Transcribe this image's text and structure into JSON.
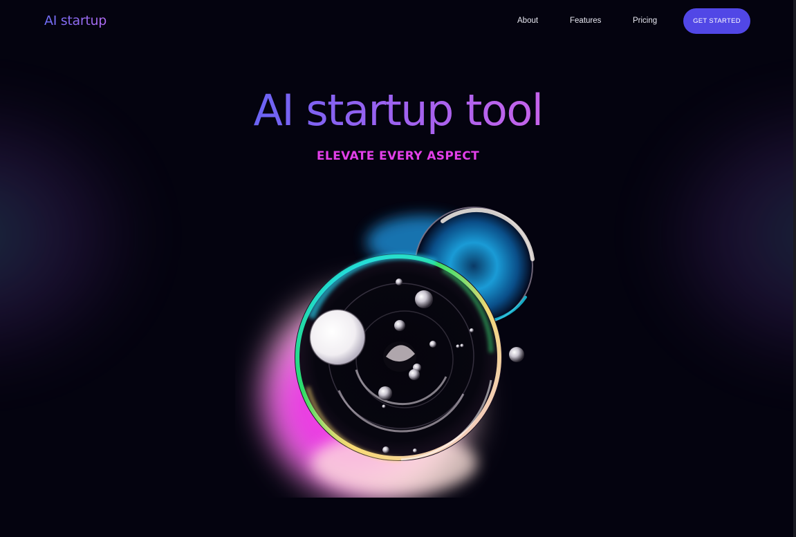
{
  "header": {
    "logo_text": "AI startup",
    "nav": {
      "about": "About",
      "features": "Features",
      "pricing": "Pricing"
    },
    "cta_label": "GET STARTED"
  },
  "hero": {
    "title": "AI startup tool",
    "subtitle": "ELEVATE EVERY ASPECT",
    "art_description_icon": "glass-bubbles-icon"
  },
  "colors": {
    "background": "#04030f",
    "brand_gradient_start": "#6a63f3",
    "brand_gradient_end": "#c663ea",
    "subtitle": "#e23fe9",
    "cta_background": "#5147e6"
  }
}
